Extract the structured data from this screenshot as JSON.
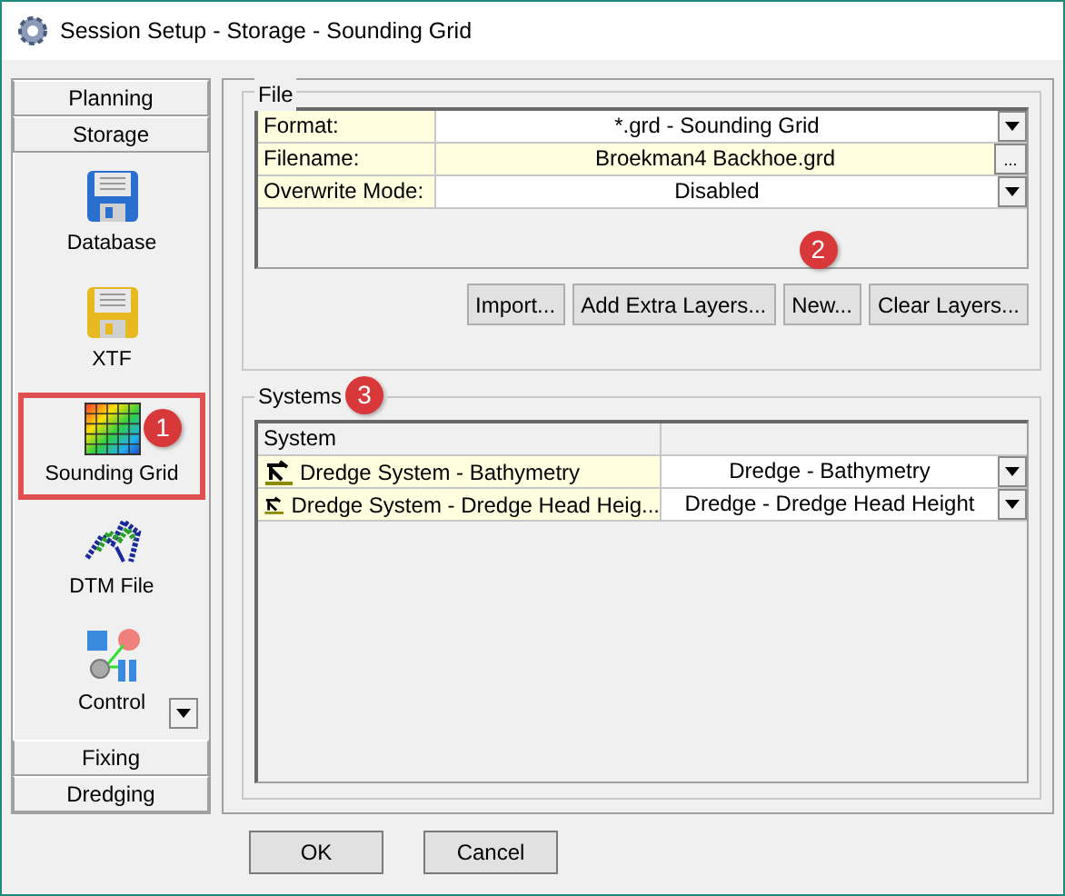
{
  "window": {
    "title": "Session Setup - Storage -  Sounding Grid"
  },
  "sidebar": {
    "sections_top": [
      "Planning",
      "Storage"
    ],
    "items": [
      {
        "label": "Database",
        "selected": false
      },
      {
        "label": "XTF",
        "selected": false
      },
      {
        "label": "Sounding Grid",
        "selected": true,
        "badge": "1"
      },
      {
        "label": "DTM File",
        "selected": false
      },
      {
        "label": "Control",
        "selected": false
      }
    ],
    "sections_bottom": [
      "Fixing",
      "Dredging"
    ]
  },
  "file": {
    "legend": "File",
    "rows": [
      {
        "label": "Format:",
        "value": "*.grd - Sounding Grid",
        "kind": "dropdown",
        "highlighted": false
      },
      {
        "label": "Filename:",
        "value": "Broekman4 Backhoe.grd",
        "kind": "browse",
        "button_text": "...",
        "highlighted": true
      },
      {
        "label": "Overwrite Mode:",
        "value": "Disabled",
        "kind": "dropdown",
        "highlighted": false
      }
    ],
    "buttons": [
      {
        "label": "Import..."
      },
      {
        "label": "Add Extra Layers..."
      },
      {
        "label": "New...",
        "badge": "2"
      },
      {
        "label": "Clear Layers..."
      }
    ]
  },
  "systems": {
    "legend": "Systems",
    "badge": "3",
    "columns": [
      "System"
    ],
    "rows": [
      {
        "name": "Dredge System - Bathymetry",
        "value": "Dredge - Bathymetry"
      },
      {
        "name": "Dredge System - Dredge Head Heig...",
        "value": "Dredge - Dredge Head Height"
      }
    ]
  },
  "buttons": [
    "OK",
    "Cancel"
  ]
}
